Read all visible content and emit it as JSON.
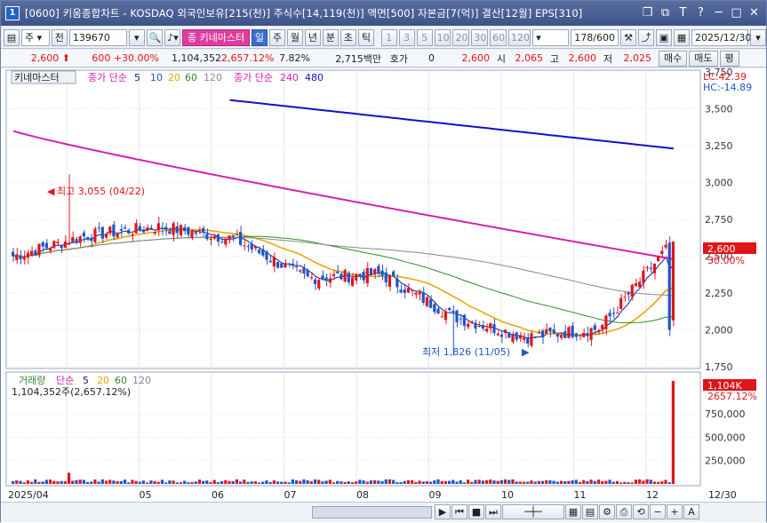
{
  "window": {
    "app_icon": "1",
    "title": "[0600] 키움종합차트 - KOSDAQ 외국인보유[215(천)] 주식수[14,119(천)] 액면[500] 자본금[7(억)] 결산[12월] EPS[310]",
    "buttons": [
      "❐",
      "⧉",
      "T",
      "?",
      "─",
      "□",
      "✕"
    ]
  },
  "toolbar": {
    "market_type": "주",
    "prev_label": "전",
    "stock_code": "139670",
    "stock_name": "키네마스터",
    "periods": [
      "일",
      "주",
      "월",
      "년",
      "분",
      "초",
      "틱"
    ],
    "active_period": "일",
    "tick_values": [
      "1",
      "3",
      "5",
      "10",
      "20",
      "30",
      "60",
      "120"
    ],
    "count_value": "178",
    "count_total": "/600",
    "date_value": "2025/12/30"
  },
  "quote": {
    "price": "2,600",
    "change": "600",
    "change_pct": "+30.00%",
    "volume": "1,104,352",
    "volume_ratio": "2,657.12%",
    "turnover_pct": "7.82%",
    "amount": "2,715백만",
    "hoga_label": "호가",
    "hoga_value": "0",
    "hoga_price": "2,600",
    "open_label": "시",
    "open_value": "2,065",
    "high_label": "고",
    "high_value": "2,600",
    "low_label": "저",
    "low_value": "2,025",
    "buy_label": "매수",
    "sell_label": "매도",
    "eval_label": "평"
  },
  "price_legend": {
    "name": "키네마스터",
    "ma_label": "종가 단순",
    "ma_periods": [
      "5",
      "10",
      "20",
      "60",
      "120"
    ],
    "ma2_label": "종가 단순",
    "ma2_periods": [
      "240",
      "480"
    ]
  },
  "price_annotations": {
    "high": "최고 3,055 (04/22)",
    "low": "최저 1,826 (11/05)",
    "lc": "LC:42.39",
    "hc": "HC:-14.89",
    "last_price": "2,600",
    "last_pct": "30.00%"
  },
  "volume_legend": {
    "label": "거래량",
    "ma_label": "단순",
    "ma_periods": [
      "5",
      "20",
      "60",
      "120"
    ],
    "current": "1,104,352주(2,657.12%)",
    "last_vol": "1,104K",
    "last_pct": "2657.12%"
  },
  "x_labels": [
    "2025/04",
    "05",
    "06",
    "07",
    "08",
    "09",
    "10",
    "11",
    "12"
  ],
  "x_end_label": "12/30",
  "colors": {
    "up": "#e0151b",
    "down": "#1e55c8",
    "ma5": "#1a1a8c",
    "ma20": "#e8a300",
    "ma60": "#2e8b2e",
    "ma120": "#888888",
    "ma240": "#d61fae",
    "ma480": "#1010c8"
  },
  "chart_data": {
    "type": "candlestick",
    "y_axis_ticks": [
      "3,750",
      "3,500",
      "3,250",
      "3,000",
      "2,750",
      "2,500",
      "2,250",
      "2,000",
      "1,750"
    ],
    "ylim": [
      1750,
      3750
    ],
    "volume_ticks": [
      "750,000",
      "500,000",
      "250,000"
    ],
    "volume_ylim": [
      0,
      1104352
    ],
    "series_close_approx": [
      {
        "month": "04",
        "close": 2500
      },
      {
        "month": "05",
        "close": 2640
      },
      {
        "month": "06",
        "close": 2700
      },
      {
        "month": "07",
        "close": 2620
      },
      {
        "month": "08",
        "close": 2350
      },
      {
        "month": "09",
        "close": 2380
      },
      {
        "month": "10",
        "close": 2090
      },
      {
        "month": "11",
        "close": 1950
      },
      {
        "month": "12",
        "close": 2010
      },
      {
        "month": "12/30",
        "close": 2600
      }
    ],
    "ma240_end": 2480,
    "ma480_end": 3230,
    "high": 3055,
    "low": 1826
  }
}
